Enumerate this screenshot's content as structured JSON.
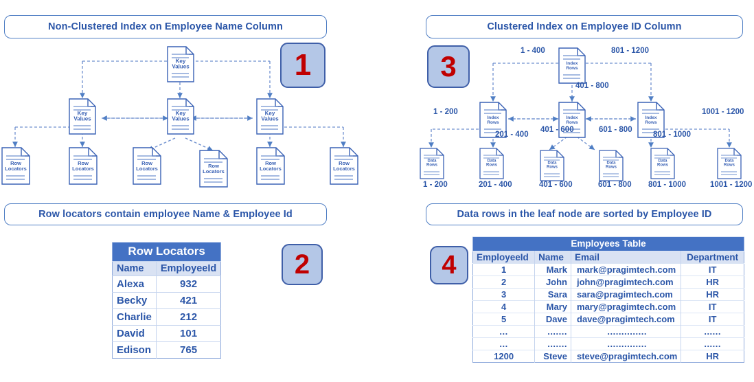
{
  "panels": {
    "left": {
      "title_top": "Non-Clustered Index on Employee Name Column",
      "title_bottom": "Row locators contain employee Name & Employee Id",
      "badge_tree": "1",
      "badge_table": "2",
      "root_label": "Key\nValues",
      "mid_label": "Key\nValues",
      "leaf_label": "Row\nLocators",
      "mid_nodes": [
        "Key\nValues",
        "Key\nValues",
        "Key\nValues"
      ],
      "leaf_nodes": [
        "Row\nLocators",
        "Row\nLocators",
        "Row\nLocators",
        "Row\nLocators",
        "Row\nLocators",
        "Row\nLocators"
      ]
    },
    "right": {
      "title_top": "Clustered Index on Employee ID Column",
      "title_bottom": "Data rows in the leaf node are sorted by Employee ID",
      "badge_tree": "3",
      "badge_table": "4",
      "root_label": "Index\nRows",
      "mid_label": "Index\nRows",
      "leaf_label": "Data\nRows",
      "mid_nodes": [
        "Index\nRows",
        "Index\nRows",
        "Index\nRows"
      ],
      "leaf_nodes": [
        "Data\nRows",
        "Data\nRows",
        "Data\nRows",
        "Data\nRows",
        "Data\nRows",
        "Data\nRows"
      ],
      "edge_labels": {
        "root_left": "1 - 400",
        "root_mid": "401 - 800",
        "root_right": "801 - 1200",
        "mid1_left": "1 - 200",
        "mid1_right": "201 - 400",
        "mid2_left": "401 - 600",
        "mid2_right": "601 - 800",
        "mid3_left": "801 - 1000",
        "mid3_right": "1001 - 1200"
      },
      "leaf_captions": [
        "1 - 200",
        "201 - 400",
        "401 - 600",
        "601 - 800",
        "801 - 1000",
        "1001 - 1200"
      ]
    }
  },
  "row_locators_table": {
    "caption": "Row Locators",
    "columns": [
      "Name",
      "EmployeeId"
    ],
    "rows": [
      [
        "Alexa",
        "932"
      ],
      [
        "Becky",
        "421"
      ],
      [
        "Charlie",
        "212"
      ],
      [
        "David",
        "101"
      ],
      [
        "Edison",
        "765"
      ]
    ]
  },
  "employees_table": {
    "caption": "Employees Table",
    "columns": [
      "EmployeeId",
      "Name",
      "Email",
      "Department"
    ],
    "rows": [
      [
        "1",
        "Mark",
        "mark@pragimtech.com",
        "IT"
      ],
      [
        "2",
        "John",
        "john@pragimtech.com",
        "HR"
      ],
      [
        "3",
        "Sara",
        "sara@pragimtech.com",
        "HR"
      ],
      [
        "4",
        "Mary",
        "mary@pragimtech.com",
        "IT"
      ],
      [
        "5",
        "Dave",
        "dave@pragimtech.com",
        "IT"
      ],
      [
        "...",
        ".......",
        "..............",
        "......"
      ],
      [
        "...",
        ".......",
        "..............",
        "......"
      ],
      [
        "1200",
        "Steve",
        "steve@pragimtech.com",
        "HR"
      ]
    ]
  },
  "colors": {
    "accent_blue": "#2b56a8",
    "node_blue": "#3a62b5",
    "border_blue": "#4f7ec4",
    "badge_fill": "#b4c7e7",
    "badge_text": "#c00000",
    "table_header": "#4472c4",
    "table_subheader": "#d9e2f3"
  }
}
